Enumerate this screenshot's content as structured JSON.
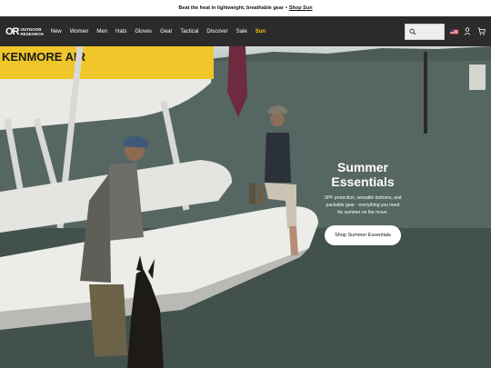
{
  "announcement": {
    "text": "Beat the heat in lightweight, breathable gear",
    "separator": "•",
    "link": "Shop Sun"
  },
  "nav": {
    "logo_mark": "OR",
    "logo_line1": "OUTDOOR",
    "logo_line2": "RESEARCH",
    "links": [
      "New",
      "Women",
      "Men",
      "Hats",
      "Gloves",
      "Gear",
      "Tactical",
      "Discover",
      "Sale",
      "Sun"
    ],
    "highlight_color": "#f5c400"
  },
  "hero": {
    "plane_text": "KENMORE AIR",
    "title_line1": "Summer",
    "title_line2": "Essentials",
    "subtitle": "UPF protection, versatile bottoms, and packable gear - everything you need for summer on the move.",
    "cta": "Shop Summer Essentials"
  },
  "icons": [
    "or-logo-icon",
    "search-icon",
    "us-flag-icon",
    "user-icon",
    "cart-icon"
  ],
  "colors": {
    "nav_bg": "#2b2b2b",
    "accent": "#f5c400"
  }
}
